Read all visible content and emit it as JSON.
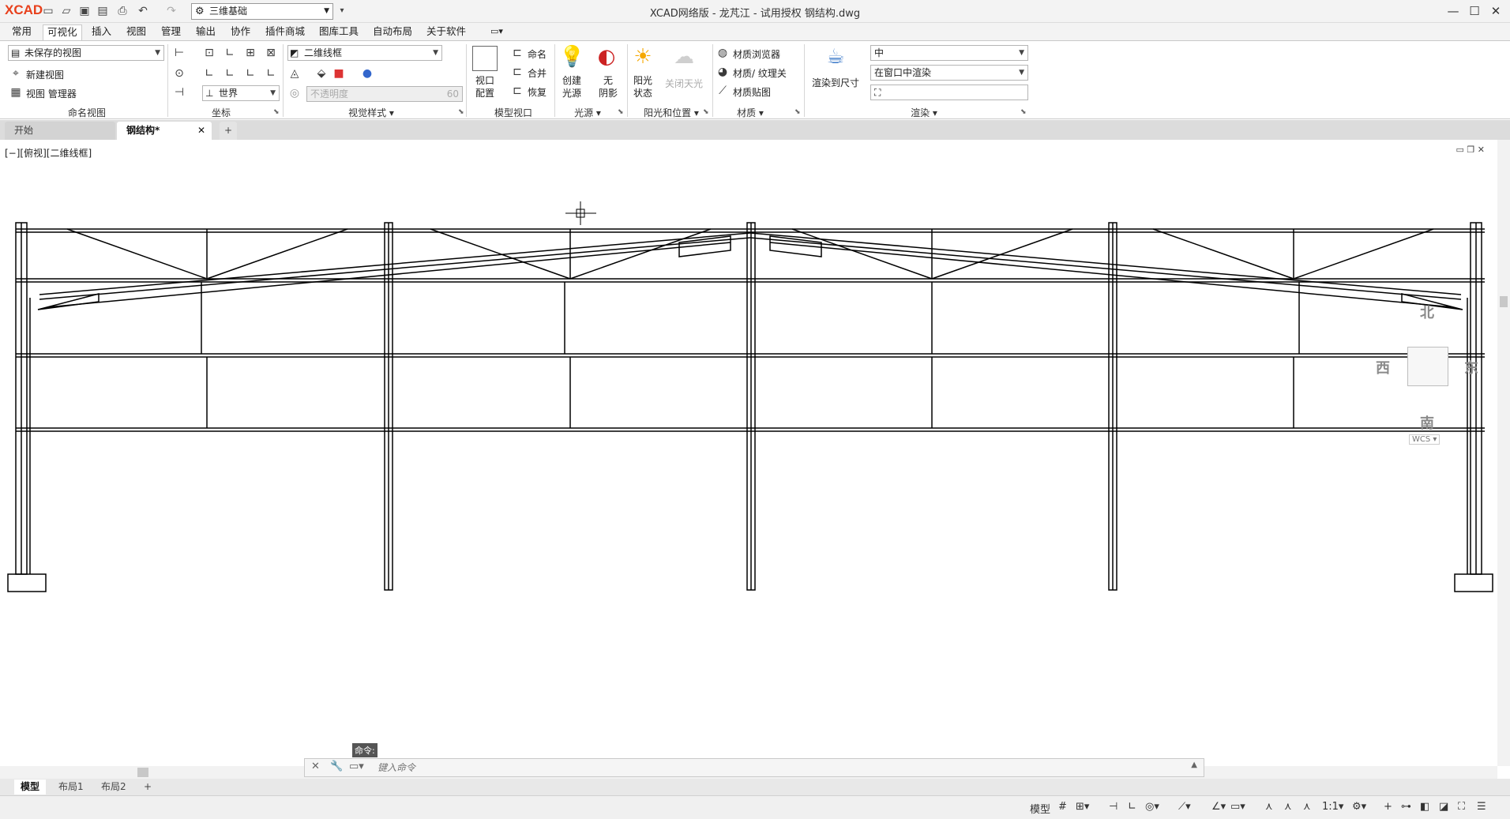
{
  "app": {
    "logo": "XCAD",
    "title": "XCAD网络版 - 龙芃江 - 试用授权    钢结构.dwg"
  },
  "workspace": {
    "value": "三维基础"
  },
  "menu": [
    "常用",
    "可视化",
    "插入",
    "视图",
    "管理",
    "输出",
    "协作",
    "插件商城",
    "图库工具",
    "自动布局",
    "关于软件"
  ],
  "menu_active": 1,
  "ribbon": {
    "named_view": {
      "select": "未保存的视图",
      "new": "新建视图",
      "manager": "视图 管理器",
      "label": "命名视图"
    },
    "coord": {
      "ucs": "世界",
      "label": "坐标"
    },
    "visual_style": {
      "select": "二维线框",
      "opacity_placeholder": "不透明度",
      "opacity_value": "60",
      "label": "视觉样式"
    },
    "model_viewport": {
      "config": "视口\n配置",
      "name": "命名",
      "merge": "合并",
      "restore": "恢复",
      "label": "模型视口"
    },
    "light": {
      "create": "创建\n光源",
      "noshadow": "无\n阴影",
      "label": "光源"
    },
    "sun": {
      "status": "阳光\n状态",
      "sky": "关闭天光",
      "label": "阳光和位置"
    },
    "material": {
      "browser": "材质浏览器",
      "texture": "材质/ 纹理关",
      "mapping": "材质贴图",
      "label": "材质"
    },
    "render": {
      "to_size": "渲染到尺寸",
      "quality": "中",
      "output": "在窗口中渲染",
      "label": "渲染"
    }
  },
  "doc_tabs": [
    {
      "label": "开始"
    },
    {
      "label": "钢结构*"
    }
  ],
  "viewport": {
    "label": "[−][俯视][二维线框]"
  },
  "viewcube": {
    "n": "北",
    "s": "南",
    "e": "东",
    "w": "西",
    "wcs": "WCS"
  },
  "command": {
    "prompt": "命令:",
    "placeholder": "键入命令"
  },
  "layout_tabs": [
    "模型",
    "布局1",
    "布局2"
  ],
  "status": {
    "model": "模型",
    "scale": "1:1"
  }
}
